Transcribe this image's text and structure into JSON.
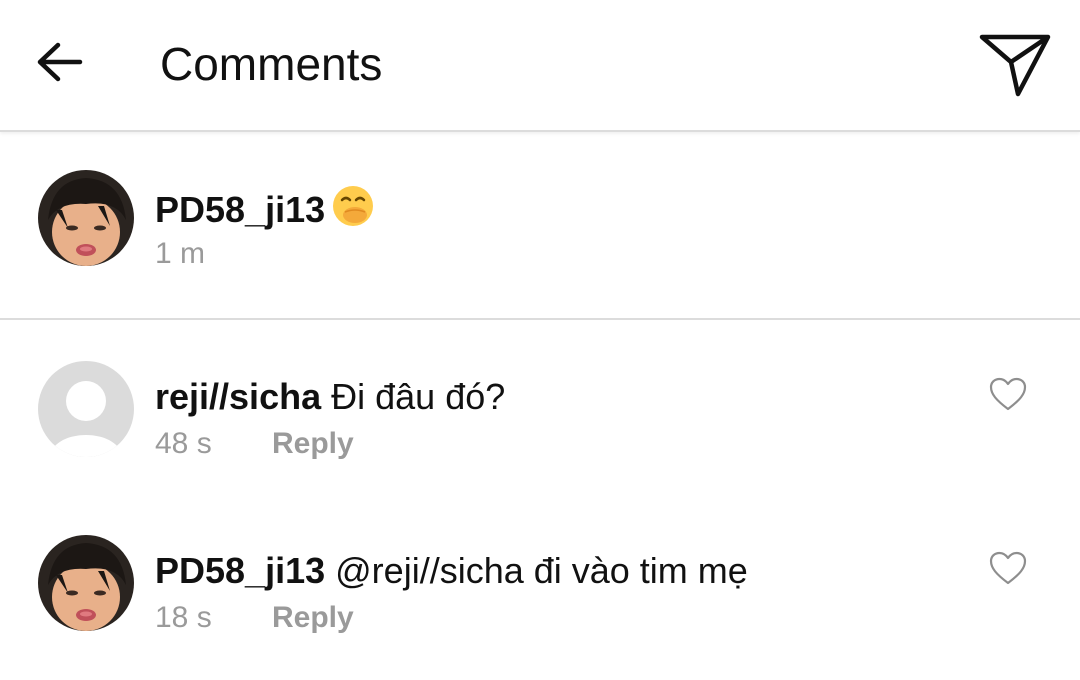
{
  "header": {
    "title": "Comments",
    "back_icon": "arrow-left-icon",
    "send_icon": "paper-plane-icon"
  },
  "caption": {
    "username": "PD58_ji13",
    "emoji": "face-with-hand-over-mouth",
    "time": "1 m"
  },
  "comments": [
    {
      "username": "reji//sicha",
      "text": "Đi đâu đó?",
      "time": "48 s",
      "reply_label": "Reply",
      "avatar": "default-avatar"
    },
    {
      "username": "PD58_ji13",
      "text": "@reji//sicha đi vào tim mẹ",
      "time": "18 s",
      "reply_label": "Reply",
      "avatar": "user-photo-avatar"
    }
  ],
  "colors": {
    "text": "#111111",
    "meta": "#9a9a9a",
    "divider": "#dcdcdc",
    "heart_outline": "#8e8e8e"
  }
}
